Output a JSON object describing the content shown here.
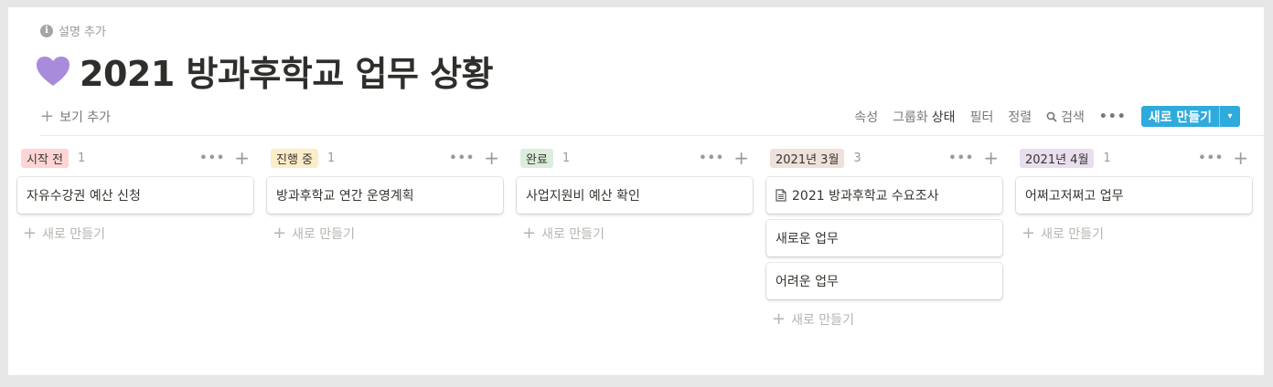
{
  "header": {
    "description_label": "설명 추가",
    "title": "2021 방과후학교 업무 상황",
    "title_icon": "purple-heart-icon"
  },
  "toolbar": {
    "add_view": "보기 추가",
    "properties": "속성",
    "group_by_label": "그룹화",
    "group_by_value": "상태",
    "filter": "필터",
    "sort": "정렬",
    "search": "검색",
    "more": "•••",
    "new_button": "새로 만들기",
    "new_button_arrow": "▾"
  },
  "colors": {
    "accent": "#2eaadc",
    "tag_not_started": "#ffcccc",
    "tag_in_progress": "#fdecc8",
    "tag_done": "#dbeddb",
    "tag_march": "#eee0da",
    "tag_april": "#e8deee"
  },
  "columns": [
    {
      "label": "시작 전",
      "count": "1",
      "color": "#ffd4d4",
      "cards": [
        {
          "title": "자유수강권 예산 신청",
          "icon": ""
        }
      ],
      "add_label": "새로 만들기"
    },
    {
      "label": "진행 중",
      "count": "1",
      "color": "#fdecc8",
      "cards": [
        {
          "title": "방과후학교 연간 운영계획",
          "icon": ""
        }
      ],
      "add_label": "새로 만들기"
    },
    {
      "label": "완료",
      "count": "1",
      "color": "#dbeddb",
      "cards": [
        {
          "title": "사업지원비 예산 확인",
          "icon": ""
        }
      ],
      "add_label": "새로 만들기"
    },
    {
      "label": "2021년 3월",
      "count": "3",
      "color": "#eee0da",
      "cards": [
        {
          "title": "2021 방과후학교 수요조사",
          "icon": "document-icon"
        },
        {
          "title": "새로운 업무",
          "icon": ""
        },
        {
          "title": "어려운 업무",
          "icon": ""
        }
      ],
      "add_label": "새로 만들기"
    },
    {
      "label": "2021년 4월",
      "count": "1",
      "color": "#e8deee",
      "cards": [
        {
          "title": "어쩌고저쩌고 업무",
          "icon": ""
        }
      ],
      "add_label": "새로 만들기"
    }
  ]
}
